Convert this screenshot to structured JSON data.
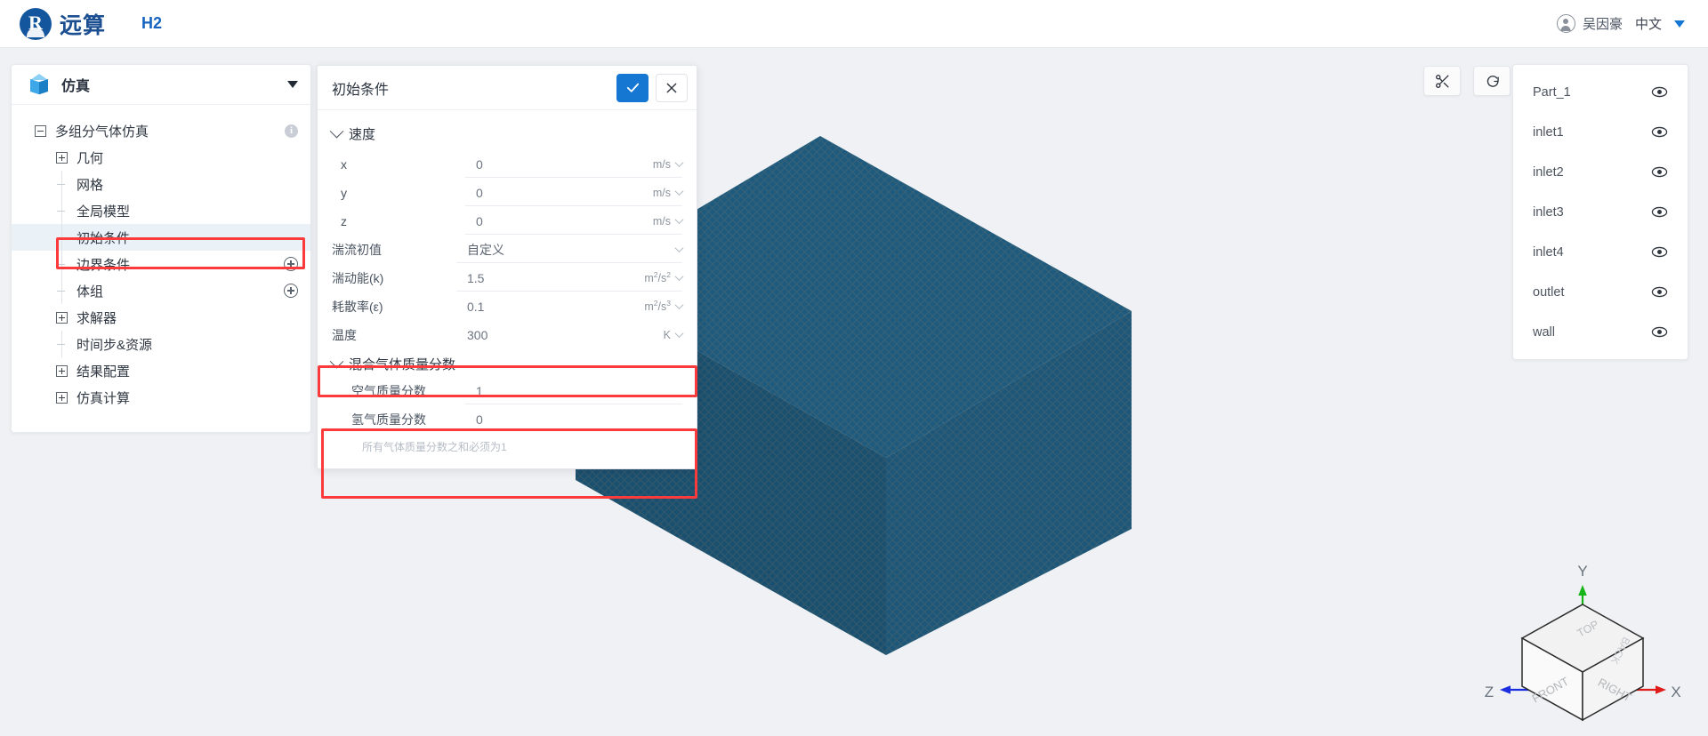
{
  "topbar": {
    "brand_glyph": "R",
    "brand_name": "远算",
    "app_tag": "H2",
    "user_name": "吴因豪",
    "language": "中文"
  },
  "sidebar": {
    "header_label": "仿真",
    "tree": [
      {
        "label": "多组分气体仿真",
        "toggle": "minus",
        "depth": 0,
        "badge": "info"
      },
      {
        "label": "几何",
        "toggle": "plus",
        "depth": 1
      },
      {
        "label": "网格",
        "toggle": "leaf",
        "depth": 1
      },
      {
        "label": "全局模型",
        "toggle": "leaf",
        "depth": 1
      },
      {
        "label": "初始条件",
        "toggle": "leaf",
        "depth": 1,
        "selected": true
      },
      {
        "label": "边界条件",
        "toggle": "leaf",
        "depth": 1,
        "badge": "add"
      },
      {
        "label": "体组",
        "toggle": "leaf",
        "depth": 1,
        "badge": "add"
      },
      {
        "label": "求解器",
        "toggle": "plus",
        "depth": 1
      },
      {
        "label": "时间步&资源",
        "toggle": "leaf",
        "depth": 1
      },
      {
        "label": "结果配置",
        "toggle": "plus",
        "depth": 1
      },
      {
        "label": "仿真计算",
        "toggle": "plus",
        "depth": 1
      }
    ]
  },
  "dialog": {
    "title": "初始条件",
    "confirm_label": "确认",
    "cancel_label": "取消",
    "sections": [
      {
        "title": "速度",
        "rows": [
          {
            "label": "x",
            "value": "0",
            "unit": "m/s"
          },
          {
            "label": "y",
            "value": "0",
            "unit": "m/s"
          },
          {
            "label": "z",
            "value": "0",
            "unit": "m/s"
          }
        ]
      }
    ],
    "turbulence_preset": {
      "label": "湍流初值",
      "value": "自定义"
    },
    "turbulence_k": {
      "label": "湍动能(k)",
      "value": "1.5",
      "unit": "m²/s²"
    },
    "turbulence_eps": {
      "label": "耗散率(ε)",
      "value": "0.1",
      "unit": "m²/s³"
    },
    "temperature": {
      "label": "温度",
      "value": "300",
      "unit": "K"
    },
    "mixture": {
      "title": "混合气体质量分数",
      "rows": [
        {
          "label": "空气质量分数",
          "value": "1"
        },
        {
          "label": "氢气质量分数",
          "value": "0"
        }
      ],
      "helper": "所有气体质量分数之和必须为1"
    }
  },
  "viewport": {
    "tools": [
      {
        "name": "clip-scissors",
        "label": "剖切"
      },
      {
        "name": "reset-view",
        "label": "重置视图"
      }
    ],
    "model_color": "#1e5a7d",
    "background_color": "#eff1f4"
  },
  "parts_panel": {
    "items": [
      {
        "name": "Part_1",
        "visible": true
      },
      {
        "name": "inlet1",
        "visible": true
      },
      {
        "name": "inlet2",
        "visible": true
      },
      {
        "name": "inlet3",
        "visible": true
      },
      {
        "name": "inlet4",
        "visible": true
      },
      {
        "name": "outlet",
        "visible": true
      },
      {
        "name": "wall",
        "visible": true
      }
    ]
  },
  "orientation_cube": {
    "faces": {
      "top": "TOP",
      "front": "FRONT",
      "right": "RIGHT",
      "back": "BACK"
    },
    "axes": [
      {
        "label": "X",
        "color": "#e01b1b"
      },
      {
        "label": "Y",
        "color": "#17b519"
      },
      {
        "label": "Z",
        "color": "#1b2ee0"
      }
    ]
  },
  "annotations": {
    "accent_color": "#fb3b3b",
    "highlights": [
      {
        "target": "sidebar-item-initial-conditions"
      },
      {
        "target": "dialog-row-temperature"
      },
      {
        "target": "dialog-mixture-rows"
      }
    ]
  }
}
